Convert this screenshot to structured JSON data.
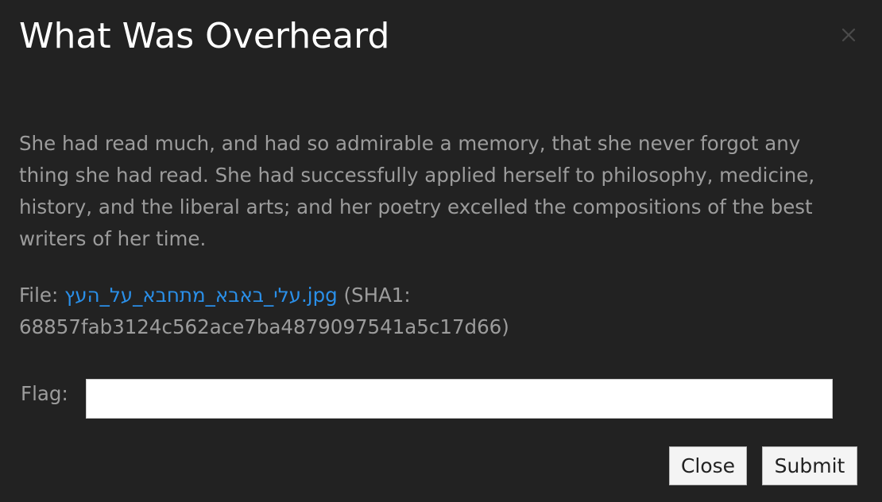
{
  "dialog": {
    "title": "What Was Overheard",
    "description": "She had read much, and had so admirable a memory, that she never forgot any thing she had read. She had successfully applied herself to philosophy, medicine, history, and the liberal arts; and her poetry excelled the compositions of the best writers of her time.",
    "file": {
      "prefix": "File: ",
      "filename": "עלי_באבא_מתחבא_על_העץ.jpg",
      "sha1_text": " (SHA1: 68857fab3124c562ace7ba4879097541a5c17d66)"
    },
    "flag": {
      "label": "Flag:",
      "value": "",
      "placeholder": ""
    },
    "buttons": {
      "close_label": "Close",
      "submit_label": "Submit"
    },
    "icons": {
      "close": "close-icon"
    }
  }
}
